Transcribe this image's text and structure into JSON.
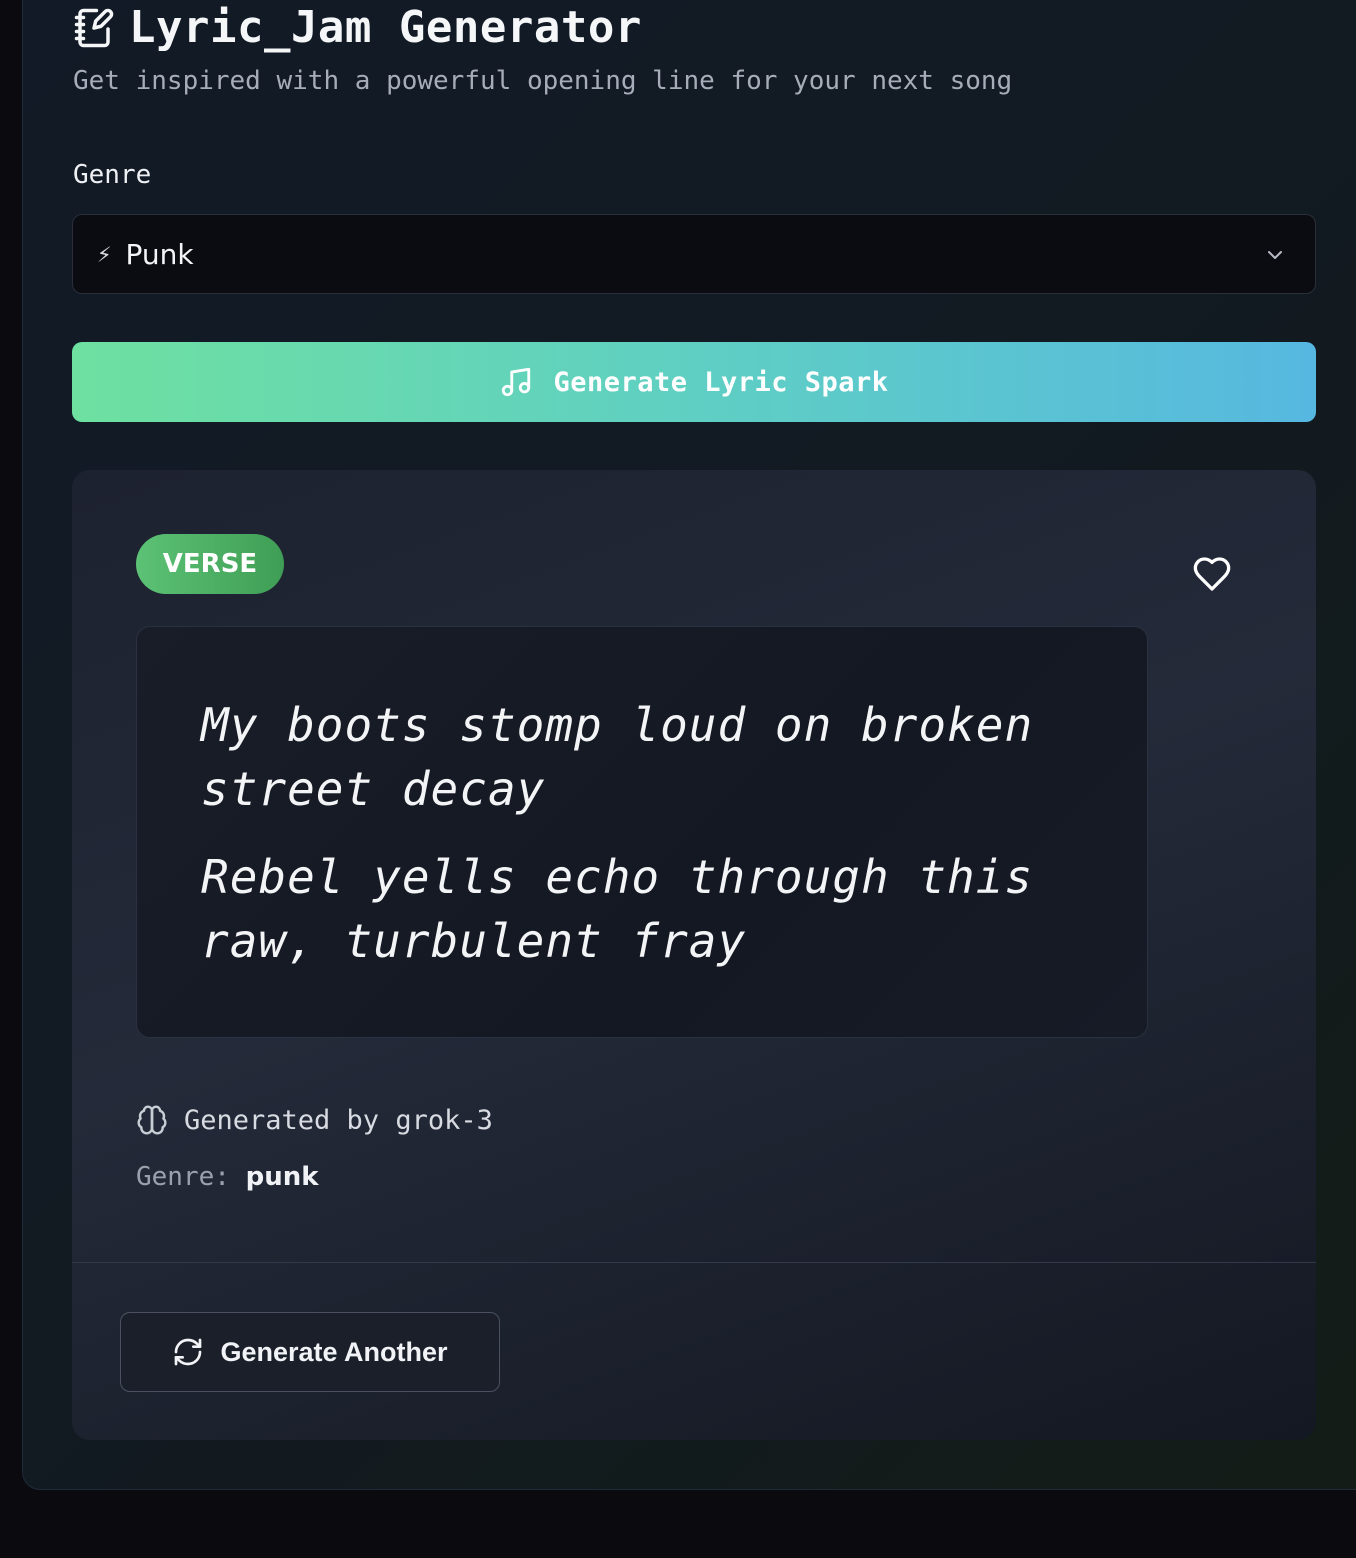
{
  "header": {
    "title": "Lyric_Jam Generator",
    "subtitle": "Get inspired with a powerful opening line for your next song"
  },
  "genre_select": {
    "label": "Genre",
    "selected_icon": "⚡",
    "selected_value": "Punk"
  },
  "generate_button": {
    "label": "Generate Lyric Spark",
    "icon": "music-note-icon"
  },
  "result": {
    "badge": "VERSE",
    "lines": [
      "My boots stomp loud on broken street decay",
      "Rebel yells echo through this raw, turbulent fray"
    ],
    "generated_by": "Generated by grok-3",
    "genre_key": "Genre:",
    "genre_value": "punk",
    "generate_another_label": "Generate Another"
  },
  "colors": {
    "accent_start": "#6ee0a0",
    "accent_end": "#56b8e0",
    "badge": "#4caf62"
  }
}
